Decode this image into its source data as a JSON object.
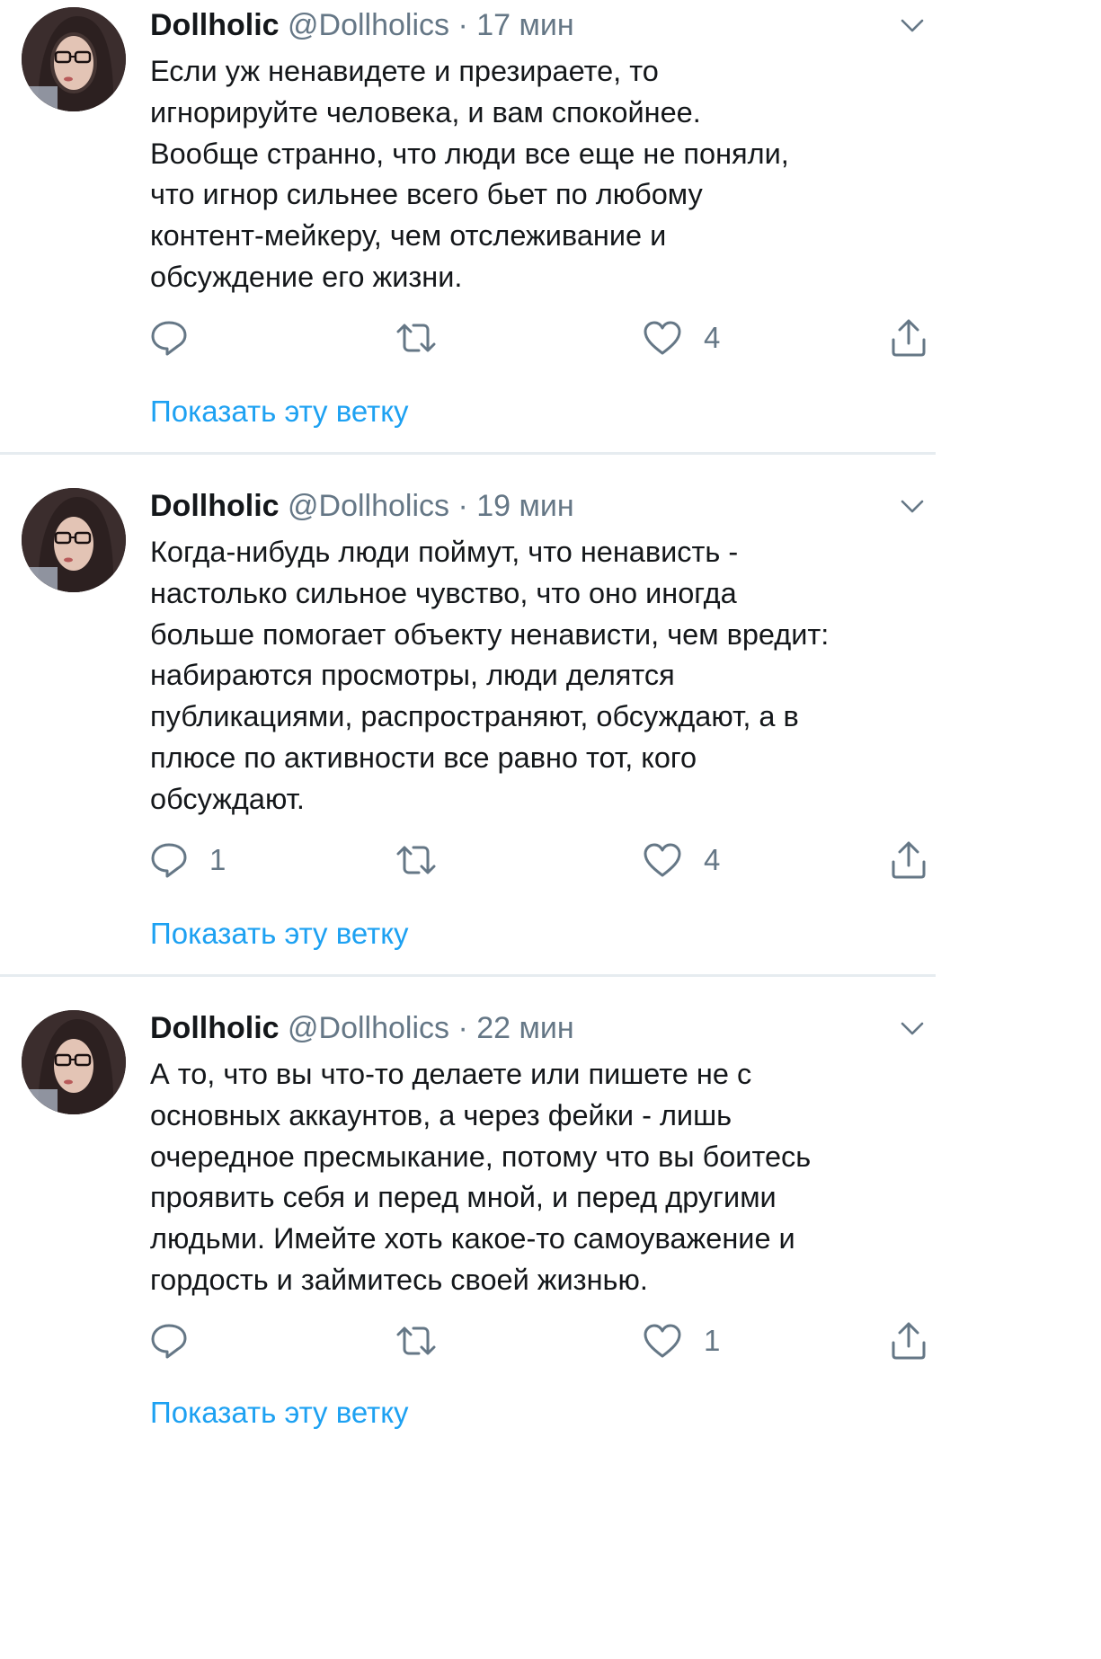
{
  "tweets": [
    {
      "name": "Dollholic",
      "handle": "@Dollholics",
      "dot": "·",
      "time": "17 мин",
      "lines": [
        "Если уж ненавидете и презираете, то",
        "игнорируйте человека, и вам спокойнее.",
        "Вообще странно, что люди все еще не поняли,",
        "что игнор сильнее всего бьет по любому",
        "контент-мейкеру, чем отслеживание и",
        "обсуждение его жизни."
      ],
      "replies": "",
      "likes": "4",
      "thread_link": "Показать эту ветку"
    },
    {
      "name": "Dollholic",
      "handle": "@Dollholics",
      "dot": "·",
      "time": "19 мин",
      "lines": [
        "Когда-нибудь люди поймут, что ненависть -",
        "настолько сильное чувство, что оно иногда",
        "больше помогает объекту ненависти, чем вредит:",
        "набираются просмотры, люди делятся",
        "публикациями,  распространяют, обсуждают, а в",
        "плюсе по активности все равно тот, кого",
        "обсуждают."
      ],
      "replies": "1",
      "likes": "4",
      "thread_link": "Показать эту ветку"
    },
    {
      "name": "Dollholic",
      "handle": "@Dollholics",
      "dot": "·",
      "time": "22 мин",
      "lines": [
        "А то, что вы что-то делаете или пишете не с",
        "основных аккаунтов, а через фейки - лишь",
        "очередное пресмыкание, потому что вы боитесь",
        "проявить себя и перед мной, и перед другими",
        "людьми. Имейте хоть какое-то самоуважение и",
        "гордость и займитесь своей жизнью."
      ],
      "replies": "",
      "likes": "1",
      "thread_link": "Показать эту ветку"
    }
  ],
  "icons": {
    "reply": "reply-icon",
    "retweet": "retweet-icon",
    "like": "heart-icon",
    "share": "share-icon",
    "menu": "chevron-down-icon"
  },
  "colors": {
    "text": "#14171a",
    "secondary": "#657786",
    "link": "#1da1f2",
    "separator": "#e6ecf0"
  }
}
